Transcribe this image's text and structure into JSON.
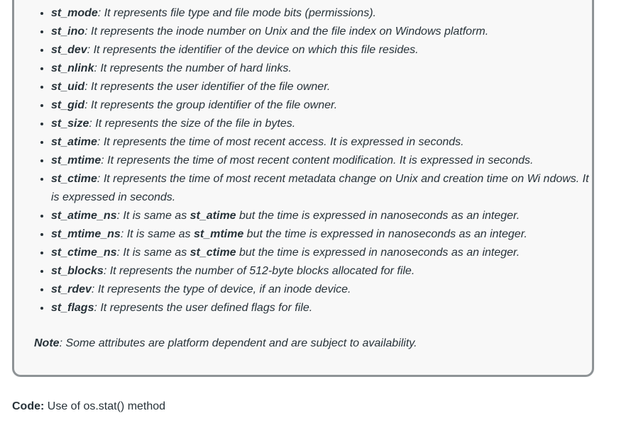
{
  "attributes": [
    {
      "name": "st_mode",
      "desc": ": It represents file type and file mode bits (permissions)."
    },
    {
      "name": "st_ino",
      "desc": ": It represents the inode number on Unix and the file index on Windows platform."
    },
    {
      "name": "st_dev",
      "desc": ": It represents the identifier of the device on which this file resides."
    },
    {
      "name": "st_nlink",
      "desc": ": It represents the number of hard links."
    },
    {
      "name": "st_uid",
      "desc": ": It represents the user identifier of the file owner."
    },
    {
      "name": "st_gid",
      "desc": ": It represents the group identifier of the file owner."
    },
    {
      "name": "st_size",
      "desc": ": It represents the size of the file in bytes."
    },
    {
      "name": "st_atime",
      "desc": ": It represents the time of most recent access. It is expressed in seconds."
    },
    {
      "name": "st_mtime",
      "desc": ": It represents the time of most recent content modification. It is expressed in seconds."
    },
    {
      "name": "st_ctime",
      "desc": ": It represents the time of most recent metadata change on Unix and creation time on Wi ndows. It is expressed in seconds."
    },
    {
      "name": "st_atime_ns",
      "pre": ": It is same as ",
      "ref": "st_atime",
      "post": " but the time is expressed in nanoseconds as an integer."
    },
    {
      "name": "st_mtime_ns",
      "pre": ": It is same as ",
      "ref": "st_mtime",
      "post": " but the time is expressed in nanoseconds as an integer."
    },
    {
      "name": "st_ctime_ns",
      "pre": ": It is same as ",
      "ref": "st_ctime",
      "post": " but the time is expressed in nanoseconds as an integer."
    },
    {
      "name": "st_blocks",
      "desc": ": It represents the number of 512-byte blocks allocated for file."
    },
    {
      "name": "st_rdev",
      "desc": ": It represents the type of device, if an inode device."
    },
    {
      "name": "st_flags",
      "desc": ": It represents the user defined flags for file."
    }
  ],
  "note": {
    "label": "Note",
    "text": ": Some attributes are platform dependent and are subject to availability."
  },
  "code": {
    "label": "Code:",
    "text": " Use of os.stat() method"
  }
}
